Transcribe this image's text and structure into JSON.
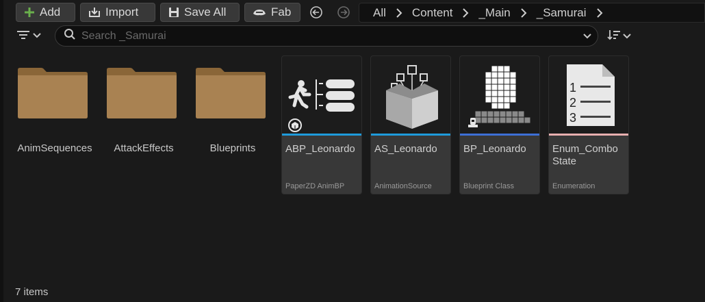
{
  "toolbar": {
    "add_label": "Add",
    "import_label": "Import",
    "save_all_label": "Save All",
    "fab_label": "Fab"
  },
  "breadcrumb": {
    "items": [
      "All",
      "Content",
      "_Main",
      "_Samurai"
    ]
  },
  "search": {
    "placeholder": "Search _Samurai",
    "value": ""
  },
  "folders": [
    {
      "label": "AnimSequences"
    },
    {
      "label": "AttackEffects"
    },
    {
      "label": "Blueprints"
    }
  ],
  "assets": [
    {
      "name": "ABP_Leonardo",
      "type": "PaperZD AnimBP",
      "bar_color": "#1e9bdc"
    },
    {
      "name": "AS_Leonardo",
      "type": "AnimationSource",
      "bar_color": "#1e9bdc"
    },
    {
      "name": "BP_Leonardo",
      "type": "Blueprint Class",
      "bar_color": "#3d6fd6"
    },
    {
      "name": "Enum_Combo State",
      "type": "Enumeration",
      "bar_color": "#e8b0b0"
    }
  ],
  "status": {
    "item_count": "7 items"
  },
  "icons": {
    "add": "plus-icon",
    "import": "import-icon",
    "save_all": "save-icon",
    "fab": "fab-icon",
    "back": "back-arrow-icon",
    "forward": "forward-arrow-icon",
    "filter": "filter-icon",
    "search": "search-icon",
    "sort": "sort-icon"
  },
  "colors": {
    "add_accent": "#6ab04c",
    "folder": "#a98252",
    "background": "#1a1a1a"
  }
}
